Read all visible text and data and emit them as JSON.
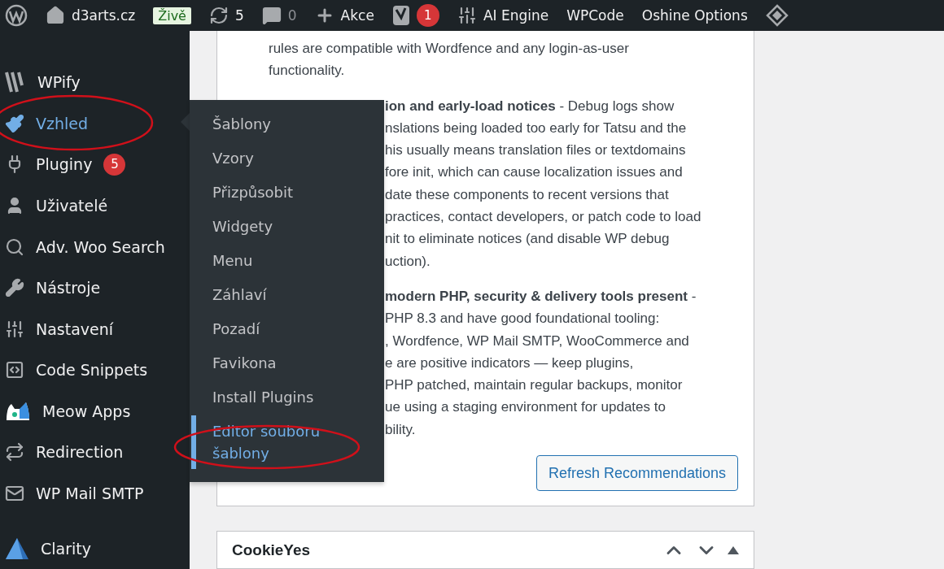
{
  "admin_bar": {
    "site": "d3arts.cz",
    "status": "Živě",
    "updates": "5",
    "comments": "0",
    "new_label": "Akce",
    "seo_count": "1",
    "links": [
      "AI Engine",
      "WPCode",
      "Oshine Options"
    ]
  },
  "sidebar": {
    "items": [
      {
        "label": "WPify",
        "selected": false
      },
      {
        "label": "Vzhled",
        "selected": true
      },
      {
        "label": "Pluginy",
        "selected": false,
        "badge": "5"
      },
      {
        "label": "Uživatelé",
        "selected": false
      },
      {
        "label": "Adv. Woo Search",
        "selected": false
      },
      {
        "label": "Nástroje",
        "selected": false
      },
      {
        "label": "Nastavení",
        "selected": false
      },
      {
        "label": "Code Snippets",
        "selected": false
      },
      {
        "label": "Meow Apps",
        "selected": false
      },
      {
        "label": "Redirection",
        "selected": false
      },
      {
        "label": "WP Mail SMTP",
        "selected": false
      },
      {
        "label": "Clarity",
        "selected": false
      }
    ]
  },
  "submenu": {
    "items": [
      {
        "label": "Šablony",
        "selected": false
      },
      {
        "label": "Vzory",
        "selected": false
      },
      {
        "label": "Přizpůsobit",
        "selected": false
      },
      {
        "label": "Widgety",
        "selected": false
      },
      {
        "label": "Menu",
        "selected": false
      },
      {
        "label": "Záhlaví",
        "selected": false
      },
      {
        "label": "Pozadí",
        "selected": false
      },
      {
        "label": "Favikona",
        "selected": false
      },
      {
        "label": "Install Plugins",
        "selected": false
      },
      {
        "label": "Editor souboru šablony",
        "selected": true
      }
    ]
  },
  "recommendations": {
    "lines_above_submenu": [
      "rules are compatible with Wordfence and any login-as-user",
      "functionality."
    ],
    "paragraphs_beside_submenu": [
      [
        "**ion and early-load notices** - Debug logs show",
        "nslations being loaded too early for Tatsu and the",
        "his usually means translation files or textdomains",
        "fore init, which can cause localization issues and",
        "date these components to recent versions that",
        "practices, contact developers, or patch code to load",
        "nit to eliminate notices (and disable WP debug",
        "uction)."
      ],
      [
        "**modern PHP, security & delivery tools present** -",
        "PHP 8.3 and have good foundational tooling:",
        ", Wordfence, WP Mail SMTP, WooCommerce and",
        "e are positive indicators — keep plugins,",
        "PHP patched, maintain regular backups, monitor",
        "ue using a staging environment for updates to",
        "bility."
      ]
    ],
    "button": "Refresh Recommendations"
  },
  "cookie_panel": {
    "title": "CookieYes"
  }
}
